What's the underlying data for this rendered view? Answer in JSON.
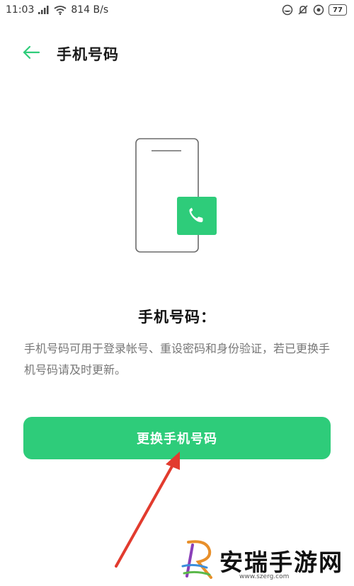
{
  "status_bar": {
    "time": "11:03",
    "network_speed": "814 B/s",
    "battery": "77",
    "icons": [
      "signal-icon",
      "wifi-icon",
      "vpn-icon",
      "mute-icon",
      "sync-icon",
      "battery-icon"
    ]
  },
  "header": {
    "title": "手机号码",
    "back_icon": "arrow-left-icon"
  },
  "illustration": {
    "icon": "phone-call-icon",
    "accent": "#2ecc7a"
  },
  "content": {
    "heading": "手机号码：",
    "description": "手机号码可用于登录帐号、重设密码和身份验证，若已更换手机号码请及时更新。"
  },
  "actions": {
    "change_phone_label": "更换手机号码"
  },
  "annotation": {
    "arrow_color": "#e23b2e"
  },
  "watermark": {
    "brand": "安瑞手游网",
    "url": "www.szerg.com"
  },
  "colors": {
    "accent": "#2ecc7a",
    "text_primary": "#1a1a1a",
    "text_secondary": "#777777"
  }
}
